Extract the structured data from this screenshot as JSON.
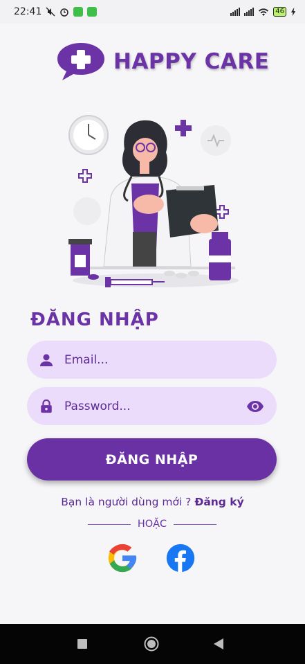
{
  "status_bar": {
    "time": "22:41",
    "battery": "46"
  },
  "app": {
    "title": "HAPPY CARE"
  },
  "login": {
    "heading": "ĐĂNG NHẬP",
    "email_placeholder": "Email...",
    "password_placeholder": "Password...",
    "submit_label": "ĐĂNG NHẬP",
    "new_user_prompt": "Bạn là người dùng mới ? ",
    "register_link": "Đăng ký",
    "or_text": "HOẶC"
  },
  "colors": {
    "primary": "#6a31a4",
    "field_bg": "#ecdcfb",
    "google": "google-icon",
    "facebook_blue": "#1877f2"
  },
  "icons": [
    "person-icon",
    "lock-icon",
    "eye-icon",
    "google-icon",
    "facebook-icon"
  ]
}
